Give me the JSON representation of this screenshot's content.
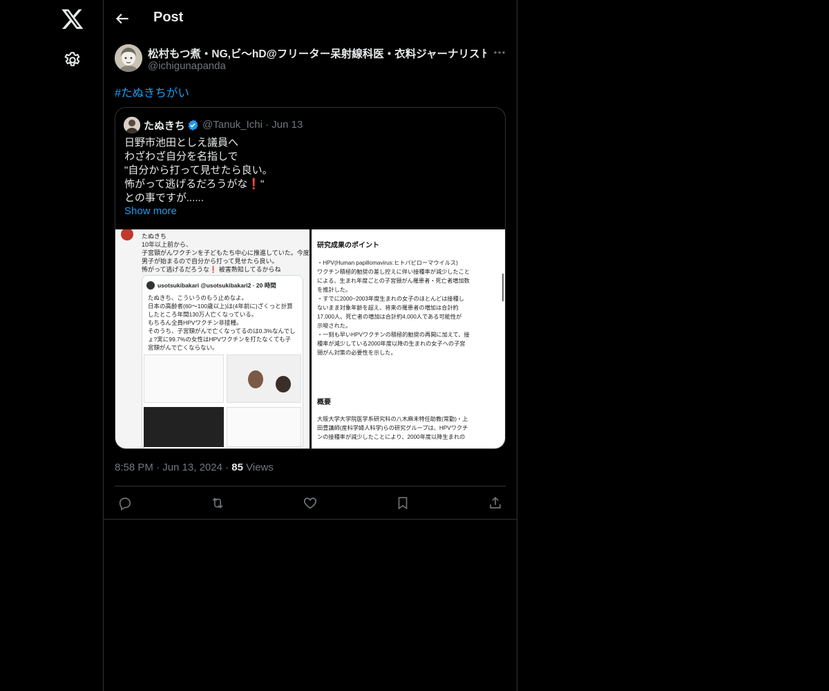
{
  "header": {
    "title": "Post"
  },
  "post": {
    "author_name": "松村もつ煮・NG,ビ〜hD@フリーター呆射線科医・衣料ジャーナリスト",
    "author_handle": "@ichigunapanda",
    "hashtag": "#たぬきちがい",
    "timestamp": "8:58 PM · Jun 13, 2024 ·",
    "views_count": "85",
    "views_label": "Views"
  },
  "quote": {
    "name": "たぬきち",
    "handle_date": "@Tanuk_Ichi · Jun 13",
    "lines": [
      "日野市池田としえ議員へ",
      "わざわざ自分を名指しで",
      "\"自分から打って見せたら良い。",
      "怖がって逃げるだろうがな❗\"",
      "との事ですが......"
    ],
    "show_more": "Show more"
  },
  "image_left": {
    "top_lines": [
      "たぬきち",
      "10年以上前から、",
      "子宮頸がんワクチンを子どもたち中心に推進していた。今度",
      "男子が始まるので自分から打って見せたら良い。",
      "怖がって逃げるだろうな❗ 被害熟知してるからね"
    ],
    "card_user": "usotsukibakari @usotsukibakari2 · 20 時間",
    "card_lines": [
      "たぬきち、こういうのもう止めなよ。",
      "日本の高齢者(60〜100歳以上)は(4年前に)ざくっと計算",
      "したところ年間130万人亡くなっている。",
      "もちろん全員HPVワクチン非接種。",
      "そのうち、子宮頸がんで亡くなってるのは0.3%なんでし",
      "ょ?実に99.7%の女性はHPVワクチンを打たなくても子",
      "宮頸がんで亡くならない。"
    ]
  },
  "image_right": {
    "heading1": "研究成果のポイント",
    "body1": [
      "・HPV(Human papillomavirus:ヒトパピローマウイルス)",
      "ワクチン積極的勧奨の差し控えに伴い接種率が減少したこと",
      "による、生まれ年度ごとの子宮頸がん罹患者・死亡者増加数",
      "を推計した。",
      "・すでに2000~2003年度生まれの女子のほとんどは接種し",
      "ないまま対象年齢を超え、将来の罹患者の増加は合計約",
      "17,000人、死亡者の増加は合計約4,000人である可能性が",
      "示唆された。",
      "・一刻も早いHPVワクチンの積極的勧奨の再開に加えて、接",
      "種率が減少している2000年度以降の生まれの女子への子宮",
      "頸がん対策の必要性を示した。"
    ],
    "heading2": "概要",
    "body2": [
      "大阪大学大学院医学系研究科の八木麻未特任助教(常勤)・上",
      "田豊講師(産科学婦人科学)らの研究グループは、HPVワクチ",
      "ンの接種率が減少したことにより、2000年度以降生まれの"
    ]
  }
}
